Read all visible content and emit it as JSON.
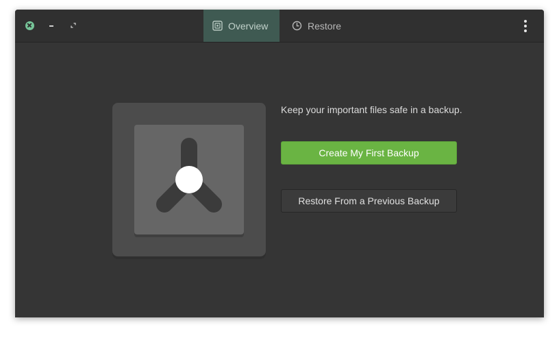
{
  "window": {
    "controls": {
      "close": "close-icon",
      "minimize": "minimize-icon",
      "maximize": "maximize-icon"
    }
  },
  "header": {
    "tabs": [
      {
        "label": "Overview",
        "icon": "overview-icon",
        "active": true
      },
      {
        "label": "Restore",
        "icon": "clock-icon",
        "active": false
      }
    ],
    "menu_icon": "more-vertical-icon"
  },
  "main": {
    "illustration_icon": "safe-vault-icon",
    "tagline": "Keep your important files safe in a backup.",
    "primary_button_label": "Create My First Backup",
    "secondary_button_label": "Restore From a Previous Backup"
  },
  "colors": {
    "window_bg": "#353535",
    "header_bg": "#303030",
    "active_tab_bg": "#3f5a52",
    "primary_button": "#6ab443",
    "close_button": "#76c498"
  }
}
